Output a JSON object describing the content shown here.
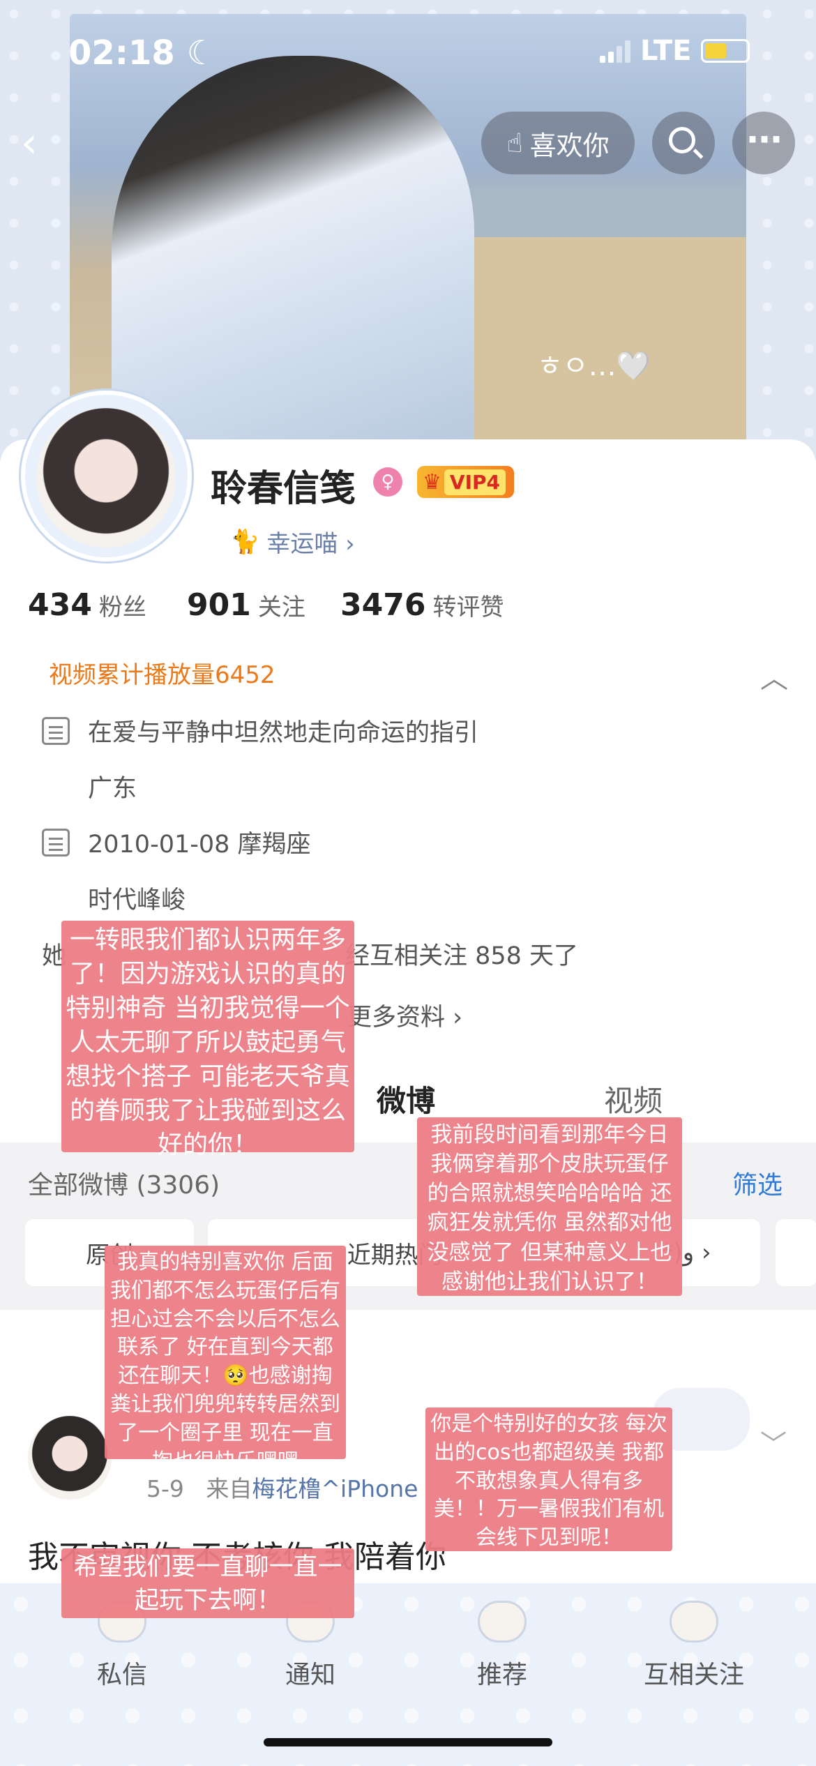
{
  "status_bar": {
    "time": "02:18",
    "carrier": "LTE"
  },
  "header": {
    "photo_overlay_text": "ㅎㅇ…🤍",
    "like_label": "喜欢你"
  },
  "profile": {
    "username": "聆春信笺",
    "vip_label": "VIP4",
    "lucky_label": "幸运喵 ›",
    "stats": {
      "fans_count": "434",
      "fans_label": "粉丝",
      "follow_count": "901",
      "follow_label": "关注",
      "interact_count": "3476",
      "interact_label": "转评赞"
    },
    "video_plays": "视频累计播放量6452",
    "bio": "在爱与平静中坦然地走向命运的指引",
    "location": "广东",
    "birthday": "2010-01-08 摩羯座",
    "company": "时代峰峻",
    "mutual_prefix": "她",
    "mutual_days": "经互相关注 858 天了",
    "more_info": "更多资料 ›"
  },
  "tabs": {
    "weibo": "微博",
    "video": "视频"
  },
  "filter": {
    "all_weibo": "全部微博 (3306)",
    "filter_label": "筛选",
    "chips": [
      "原创",
      "近期热门 ›",
      "*)و ›",
      ""
    ]
  },
  "post": {
    "date": "5-9",
    "source_prefix": "来自",
    "source": "梅花橹^iPhone",
    "text": "我不审视你 不考核你 我陪着你"
  },
  "bottom_nav": {
    "items": [
      "私信",
      "通知",
      "推荐",
      "互相关注"
    ]
  },
  "notes": [
    "一转眼我们都认识两年多了！因为游戏认识的真的特别神奇 当初我觉得一个人太无聊了所以鼓起勇气想找个搭子 可能老天爷真的眷顾我了让我碰到这么好的你！",
    "我前段时间看到那年今日我俩穿着那个皮肤玩蛋仔的合照就想笑哈哈哈哈 还疯狂发就凭你 虽然都对他没感觉了 但某种意义上也感谢他让我们认识了！",
    "我真的特别喜欢你 后面我们都不怎么玩蛋仔后有担心过会不会以后不怎么联系了 好在直到今天都还在聊天！🥺也感谢掏粪让我们兜兜转转居然到了一个圈子里 现在一直掏也很快乐嘿嘿",
    "你是个特别好的女孩 每次出的cos也都超级美 我都不敢想象真人得有多美！！万一暑假我们有机会线下见到呢！",
    "希望我们要一直聊一直一起玩下去啊！"
  ]
}
